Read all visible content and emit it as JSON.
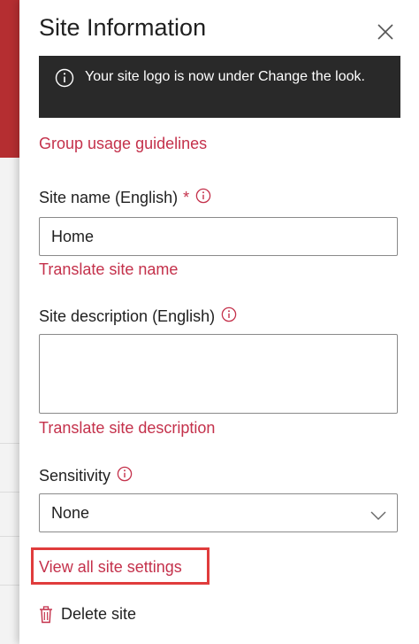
{
  "panel": {
    "title": "Site Information"
  },
  "banner": {
    "icon": "info-icon",
    "message": "Your site logo is now under Change the look."
  },
  "links": {
    "group_usage": "Group usage guidelines",
    "translate_name": "Translate site name",
    "translate_description": "Translate site description",
    "view_all_settings": "View all site settings"
  },
  "site_name": {
    "label": "Site name (English)",
    "required_mark": "*",
    "value": "Home"
  },
  "site_description": {
    "label": "Site description (English)",
    "value": ""
  },
  "sensitivity": {
    "label": "Sensitivity",
    "selected": "None"
  },
  "delete": {
    "label": "Delete site",
    "icon": "trash-icon"
  },
  "colors": {
    "accent_link": "#c4314b",
    "banner_bg": "#292929",
    "highlight_box": "#e03c3c"
  }
}
